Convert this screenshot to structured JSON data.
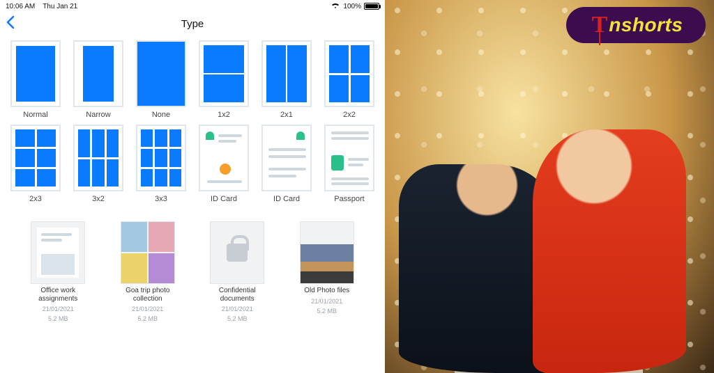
{
  "status": {
    "time": "10:06 AM",
    "date": "Thu Jan 21",
    "battery_pct": "100%"
  },
  "nav": {
    "title": "Type"
  },
  "types": [
    {
      "key": "normal",
      "label": "Normal"
    },
    {
      "key": "narrow",
      "label": "Narrow"
    },
    {
      "key": "none",
      "label": "None"
    },
    {
      "key": "1x2",
      "label": "1x2"
    },
    {
      "key": "2x1",
      "label": "2x1"
    },
    {
      "key": "2x2",
      "label": "2x2"
    },
    {
      "key": "2x3",
      "label": "2x3"
    },
    {
      "key": "3x2",
      "label": "3x2"
    },
    {
      "key": "3x3",
      "label": "3x3"
    },
    {
      "key": "idcard1",
      "label": "ID Card"
    },
    {
      "key": "idcard2",
      "label": "ID Card"
    },
    {
      "key": "passport",
      "label": "Passport"
    }
  ],
  "files": [
    {
      "name": "Office work assignments",
      "date": "21/01/2021",
      "size": "5.2 MB",
      "kind": "doc"
    },
    {
      "name": "Goa trip photo collection",
      "date": "21/01/2021",
      "size": "5.2 MB",
      "kind": "collage"
    },
    {
      "name": "Confidential documents",
      "date": "21/01/2021",
      "size": "5.2 MB",
      "kind": "locked"
    },
    {
      "name": "Old Photo files",
      "date": "21/01/2021",
      "size": "5.2 MB",
      "kind": "landscape"
    }
  ],
  "brand": {
    "first": "T",
    "rest": "nshorts"
  }
}
